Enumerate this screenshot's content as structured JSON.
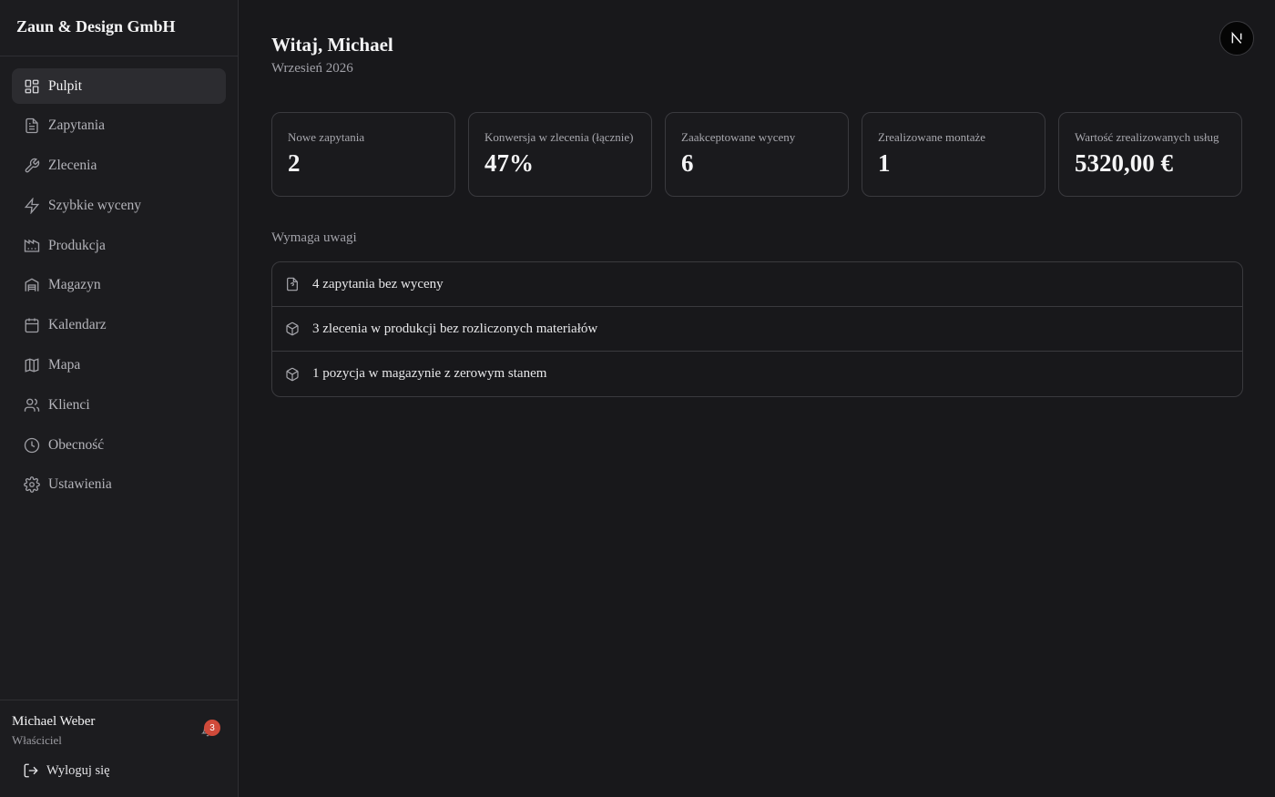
{
  "brand": "Zaun & Design GmbH",
  "nav": [
    {
      "label": "Pulpit",
      "icon": "dashboard-icon",
      "active": true
    },
    {
      "label": "Zapytania",
      "icon": "document-icon"
    },
    {
      "label": "Zlecenia",
      "icon": "wrench-icon"
    },
    {
      "label": "Szybkie wyceny",
      "icon": "lightning-icon"
    },
    {
      "label": "Produkcja",
      "icon": "factory-icon"
    },
    {
      "label": "Magazyn",
      "icon": "warehouse-icon"
    },
    {
      "label": "Kalendarz",
      "icon": "calendar-icon"
    },
    {
      "label": "Mapa",
      "icon": "map-icon"
    },
    {
      "label": "Klienci",
      "icon": "users-icon"
    },
    {
      "label": "Obecność",
      "icon": "clock-icon"
    },
    {
      "label": "Ustawienia",
      "icon": "gear-icon"
    }
  ],
  "user": {
    "name": "Michael Weber",
    "role": "Właściciel",
    "notifications": "3"
  },
  "logout_label": "Wyloguj się",
  "header": {
    "greeting": "Witaj, Michael",
    "date": "Wrzesień 2026",
    "avatar_letter": "N"
  },
  "stats": [
    {
      "label": "Nowe zapytania",
      "value": "2"
    },
    {
      "label": "Konwersja w zlecenia (łącznie)",
      "value": "47%"
    },
    {
      "label": "Zaakceptowane wyceny",
      "value": "6"
    },
    {
      "label": "Zrealizowane montaże",
      "value": "1"
    },
    {
      "label": "Wartość zrealizowanych usług",
      "value": "5320,00 €"
    }
  ],
  "attention": {
    "title": "Wymaga uwagi",
    "items": [
      {
        "text": "4 zapytania bez wyceny",
        "icon": "document-question-icon"
      },
      {
        "text": "3 zlecenia w produkcji bez rozliczonych materiałów",
        "icon": "package-icon"
      },
      {
        "text": "1 pozycja w magazynie z zerowym stanem",
        "icon": "package-icon"
      }
    ]
  },
  "colors": {
    "background": "#18181b",
    "sidebar": "#1c1c1f",
    "badge": "#d04a3a"
  }
}
